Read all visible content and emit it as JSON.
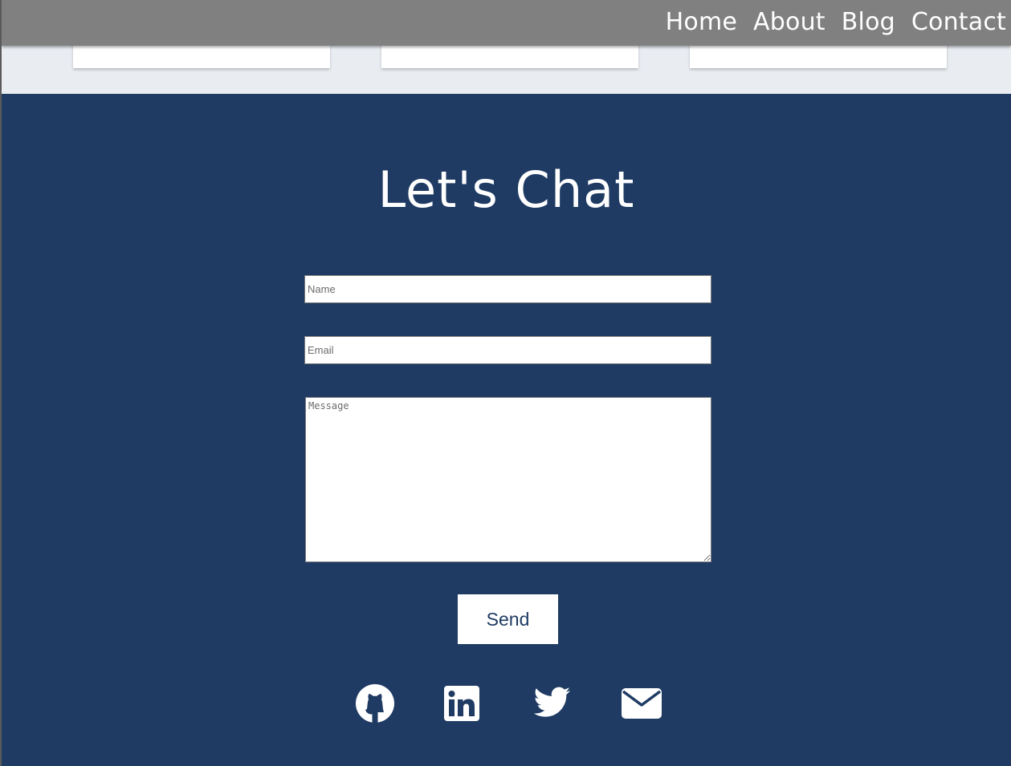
{
  "nav": {
    "links": [
      "Home",
      "About",
      "Blog",
      "Contact"
    ]
  },
  "contact": {
    "title": "Let's Chat",
    "name_placeholder": "Name",
    "email_placeholder": "Email",
    "message_placeholder": "Message",
    "send_label": "Send"
  },
  "social": {
    "icons": [
      "github-icon",
      "linkedin-icon",
      "twitter-icon",
      "mail-icon"
    ]
  },
  "colors": {
    "navbar": "#808080",
    "contact_background": "#1f3b63",
    "top_band": "#e9edf2",
    "text_on_dark": "#ffffff"
  }
}
